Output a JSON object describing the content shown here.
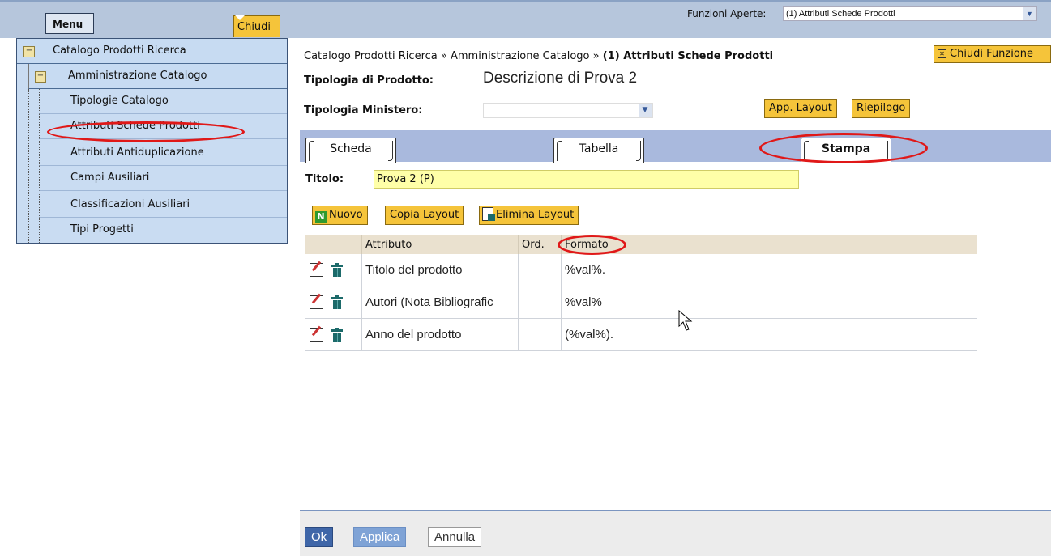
{
  "topbar": {
    "menu_label": "Menu",
    "chiudi_label": "Chiudi",
    "funzioni_label": "Funzioni Aperte:",
    "funzioni_selected": "(1) Attributi Schede Prodotti"
  },
  "sidebar": {
    "level1": "Catalogo Prodotti Ricerca",
    "level2": "Amministrazione Catalogo",
    "items": [
      {
        "label": "Tipologie Catalogo"
      },
      {
        "label": "Attributi Schede Prodotti"
      },
      {
        "label": "Attributi Antiduplicazione"
      },
      {
        "label": "Campi Ausiliari"
      },
      {
        "label": "Classificazioni Ausiliari"
      },
      {
        "label": "Tipi Progetti"
      }
    ]
  },
  "breadcrumb": {
    "part1": "Catalogo Prodotti Ricerca",
    "sep": "»",
    "part2": "Amministrazione Catalogo",
    "current": "(1) Attributi Schede Prodotti"
  },
  "chiudi_funzione": "Chiudi Funzione",
  "form": {
    "tipologia_prodotto_label": "Tipologia di Prodotto:",
    "tipologia_prodotto_value": "Descrizione di Prova 2",
    "tipologia_ministero_label": "Tipologia Ministero:",
    "tipologia_ministero_value": "",
    "app_layout": "App. Layout",
    "riepilogo": "Riepilogo"
  },
  "tabs": [
    {
      "label": "Scheda"
    },
    {
      "label": "Tabella"
    },
    {
      "label": "Stampa",
      "active": true
    }
  ],
  "titolo": {
    "label": "Titolo:",
    "value": "Prova 2 (P)"
  },
  "toolbar": {
    "nuovo": "Nuovo",
    "copia": "Copia Layout",
    "elimina": "Elimina Layout"
  },
  "table": {
    "headers": [
      "Attributo",
      "Ord.",
      "Formato"
    ],
    "rows": [
      {
        "attributo": "Titolo del prodotto",
        "ord": "",
        "formato": "%val%."
      },
      {
        "attributo": "Autori (Nota Bibliografic",
        "ord": "",
        "formato": "%val%"
      },
      {
        "attributo": "Anno del prodotto",
        "ord": "",
        "formato": "(%val%)."
      }
    ]
  },
  "footer": {
    "ok": "Ok",
    "applica": "Applica",
    "annulla": "Annulla"
  },
  "colors": {
    "accent_yellow": "#f5c43a",
    "highlight_red": "#e01818",
    "tab_strip": "#a9b9dd",
    "menu_bg": "#c9dcf2"
  }
}
